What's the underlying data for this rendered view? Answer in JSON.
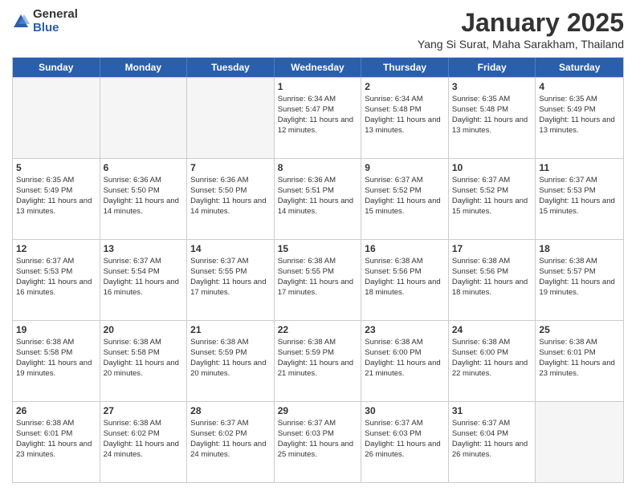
{
  "logo": {
    "general": "General",
    "blue": "Blue"
  },
  "header": {
    "month": "January 2025",
    "location": "Yang Si Surat, Maha Sarakham, Thailand"
  },
  "weekdays": [
    "Sunday",
    "Monday",
    "Tuesday",
    "Wednesday",
    "Thursday",
    "Friday",
    "Saturday"
  ],
  "rows": [
    [
      {
        "day": "",
        "info": ""
      },
      {
        "day": "",
        "info": ""
      },
      {
        "day": "",
        "info": ""
      },
      {
        "day": "1",
        "info": "Sunrise: 6:34 AM\nSunset: 5:47 PM\nDaylight: 11 hours and 12 minutes."
      },
      {
        "day": "2",
        "info": "Sunrise: 6:34 AM\nSunset: 5:48 PM\nDaylight: 11 hours and 13 minutes."
      },
      {
        "day": "3",
        "info": "Sunrise: 6:35 AM\nSunset: 5:48 PM\nDaylight: 11 hours and 13 minutes."
      },
      {
        "day": "4",
        "info": "Sunrise: 6:35 AM\nSunset: 5:49 PM\nDaylight: 11 hours and 13 minutes."
      }
    ],
    [
      {
        "day": "5",
        "info": "Sunrise: 6:35 AM\nSunset: 5:49 PM\nDaylight: 11 hours and 13 minutes."
      },
      {
        "day": "6",
        "info": "Sunrise: 6:36 AM\nSunset: 5:50 PM\nDaylight: 11 hours and 14 minutes."
      },
      {
        "day": "7",
        "info": "Sunrise: 6:36 AM\nSunset: 5:50 PM\nDaylight: 11 hours and 14 minutes."
      },
      {
        "day": "8",
        "info": "Sunrise: 6:36 AM\nSunset: 5:51 PM\nDaylight: 11 hours and 14 minutes."
      },
      {
        "day": "9",
        "info": "Sunrise: 6:37 AM\nSunset: 5:52 PM\nDaylight: 11 hours and 15 minutes."
      },
      {
        "day": "10",
        "info": "Sunrise: 6:37 AM\nSunset: 5:52 PM\nDaylight: 11 hours and 15 minutes."
      },
      {
        "day": "11",
        "info": "Sunrise: 6:37 AM\nSunset: 5:53 PM\nDaylight: 11 hours and 15 minutes."
      }
    ],
    [
      {
        "day": "12",
        "info": "Sunrise: 6:37 AM\nSunset: 5:53 PM\nDaylight: 11 hours and 16 minutes."
      },
      {
        "day": "13",
        "info": "Sunrise: 6:37 AM\nSunset: 5:54 PM\nDaylight: 11 hours and 16 minutes."
      },
      {
        "day": "14",
        "info": "Sunrise: 6:37 AM\nSunset: 5:55 PM\nDaylight: 11 hours and 17 minutes."
      },
      {
        "day": "15",
        "info": "Sunrise: 6:38 AM\nSunset: 5:55 PM\nDaylight: 11 hours and 17 minutes."
      },
      {
        "day": "16",
        "info": "Sunrise: 6:38 AM\nSunset: 5:56 PM\nDaylight: 11 hours and 18 minutes."
      },
      {
        "day": "17",
        "info": "Sunrise: 6:38 AM\nSunset: 5:56 PM\nDaylight: 11 hours and 18 minutes."
      },
      {
        "day": "18",
        "info": "Sunrise: 6:38 AM\nSunset: 5:57 PM\nDaylight: 11 hours and 19 minutes."
      }
    ],
    [
      {
        "day": "19",
        "info": "Sunrise: 6:38 AM\nSunset: 5:58 PM\nDaylight: 11 hours and 19 minutes."
      },
      {
        "day": "20",
        "info": "Sunrise: 6:38 AM\nSunset: 5:58 PM\nDaylight: 11 hours and 20 minutes."
      },
      {
        "day": "21",
        "info": "Sunrise: 6:38 AM\nSunset: 5:59 PM\nDaylight: 11 hours and 20 minutes."
      },
      {
        "day": "22",
        "info": "Sunrise: 6:38 AM\nSunset: 5:59 PM\nDaylight: 11 hours and 21 minutes."
      },
      {
        "day": "23",
        "info": "Sunrise: 6:38 AM\nSunset: 6:00 PM\nDaylight: 11 hours and 21 minutes."
      },
      {
        "day": "24",
        "info": "Sunrise: 6:38 AM\nSunset: 6:00 PM\nDaylight: 11 hours and 22 minutes."
      },
      {
        "day": "25",
        "info": "Sunrise: 6:38 AM\nSunset: 6:01 PM\nDaylight: 11 hours and 23 minutes."
      }
    ],
    [
      {
        "day": "26",
        "info": "Sunrise: 6:38 AM\nSunset: 6:01 PM\nDaylight: 11 hours and 23 minutes."
      },
      {
        "day": "27",
        "info": "Sunrise: 6:38 AM\nSunset: 6:02 PM\nDaylight: 11 hours and 24 minutes."
      },
      {
        "day": "28",
        "info": "Sunrise: 6:37 AM\nSunset: 6:02 PM\nDaylight: 11 hours and 24 minutes."
      },
      {
        "day": "29",
        "info": "Sunrise: 6:37 AM\nSunset: 6:03 PM\nDaylight: 11 hours and 25 minutes."
      },
      {
        "day": "30",
        "info": "Sunrise: 6:37 AM\nSunset: 6:03 PM\nDaylight: 11 hours and 26 minutes."
      },
      {
        "day": "31",
        "info": "Sunrise: 6:37 AM\nSunset: 6:04 PM\nDaylight: 11 hours and 26 minutes."
      },
      {
        "day": "",
        "info": ""
      }
    ]
  ]
}
